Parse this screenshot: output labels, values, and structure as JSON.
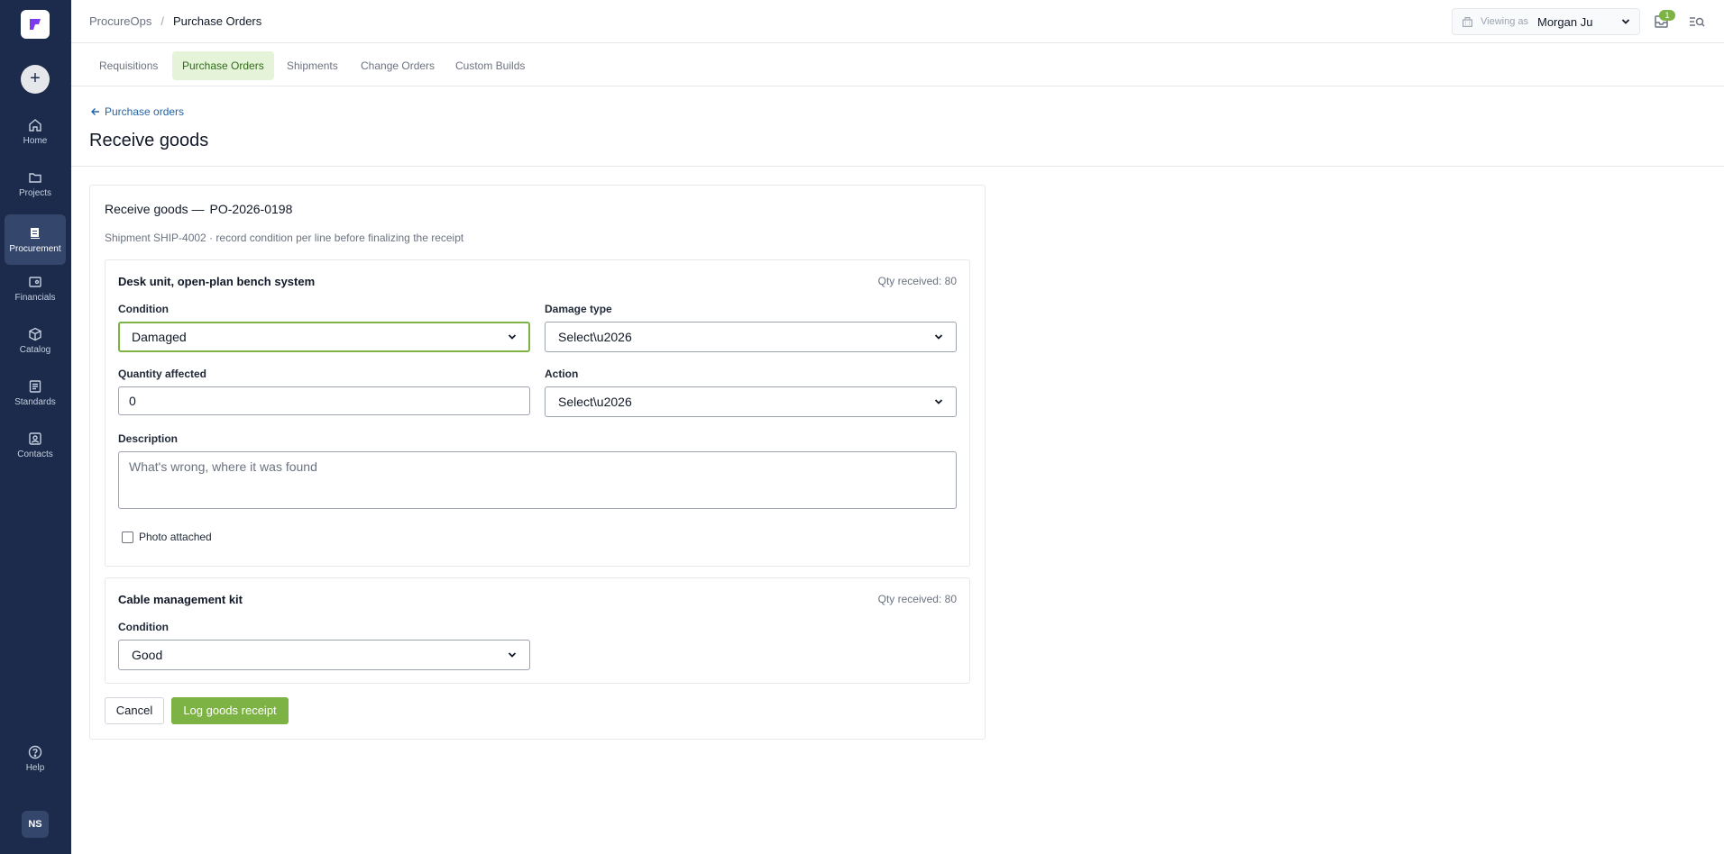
{
  "app": {
    "name": "ProcureOps",
    "current_section": "Purchase Orders"
  },
  "sidebar": {
    "add_icon": "plus-icon",
    "items": [
      {
        "label": "Home",
        "icon": "home-icon",
        "active": false
      },
      {
        "label": "Projects",
        "icon": "folder-icon",
        "active": false
      },
      {
        "label": "Procurement",
        "icon": "procurement-icon",
        "active": true
      },
      {
        "label": "Financials",
        "icon": "wallet-icon",
        "active": false
      },
      {
        "label": "Catalog",
        "icon": "box-icon",
        "active": false
      },
      {
        "label": "Standards",
        "icon": "document-list-icon",
        "active": false
      },
      {
        "label": "Contacts",
        "icon": "contact-card-icon",
        "active": false
      }
    ],
    "help": {
      "label": "Help",
      "icon": "help-icon"
    },
    "user_initials": "NS"
  },
  "topbar": {
    "viewing_label": "Viewing as",
    "viewing_user": "Morgan Ju",
    "inbox_count": "1"
  },
  "tabs": [
    {
      "label": "Requisitions",
      "active": false
    },
    {
      "label": "Purchase Orders",
      "active": true
    },
    {
      "label": "Shipments",
      "active": false
    },
    {
      "label": "Change Orders",
      "active": false
    },
    {
      "label": "Custom Builds",
      "active": false
    }
  ],
  "page": {
    "back_link": "Purchase orders",
    "title": "Receive goods"
  },
  "form": {
    "title": "Receive goods —",
    "po_number": "PO-2026-0198",
    "subtitle": "Shipment SHIP-4002 · record condition per line before finalizing the receipt",
    "lines": [
      {
        "name": "Desk unit, open-plan bench system",
        "qty_received": "Qty received: 80",
        "condition_label": "Condition",
        "condition_value": "Damaged",
        "damage_type_label": "Damage type",
        "damage_type_value": "Select\\u2026",
        "quantity_label": "Quantity affected",
        "quantity_value": "0",
        "action_label": "Action",
        "action_value": "Select\\u2026",
        "description_label": "Description",
        "description_placeholder": "What's wrong, where it was found",
        "photo_label": "Photo attached",
        "photo_checked": false
      },
      {
        "name": "Cable management kit",
        "qty_received": "Qty received: 80",
        "condition_label": "Condition",
        "condition_value": "Good"
      }
    ],
    "cancel_label": "Cancel",
    "submit_label": "Log goods receipt"
  },
  "colors": {
    "sidebar_bg": "#1c2b4b",
    "sidebar_active": "#34466b",
    "accent_green": "#7db344",
    "tab_active_bg": "#e5f3d8",
    "link_blue": "#2563a8"
  }
}
